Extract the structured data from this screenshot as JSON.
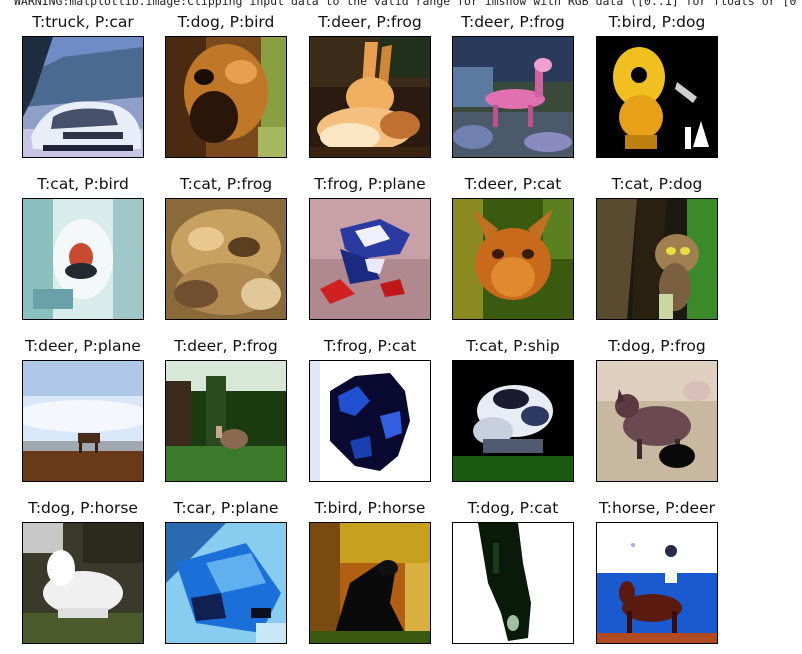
{
  "console": {
    "warning": "WARNING:matplotlib.image:Clipping input data to the valid range for imshow with RGB data ([0..1] for floats or [0"
  },
  "grid": {
    "rows": [
      [
        {
          "label": "T:truck, P:car"
        },
        {
          "label": "T:dog, P:bird"
        },
        {
          "label": "T:deer, P:frog"
        },
        {
          "label": "T:deer, P:frog"
        },
        {
          "label": "T:bird, P:dog"
        }
      ],
      [
        {
          "label": "T:cat, P:bird"
        },
        {
          "label": "T:cat, P:frog"
        },
        {
          "label": "T:frog, P:plane"
        },
        {
          "label": "T:deer, P:cat"
        },
        {
          "label": "T:cat, P:dog"
        }
      ],
      [
        {
          "label": "T:deer, P:plane"
        },
        {
          "label": "T:deer, P:frog"
        },
        {
          "label": "T:frog, P:cat"
        },
        {
          "label": "T:cat, P:ship"
        },
        {
          "label": "T:dog, P:frog"
        }
      ],
      [
        {
          "label": "T:dog, P:horse"
        },
        {
          "label": "T:car, P:plane"
        },
        {
          "label": "T:bird, P:horse"
        },
        {
          "label": "T:dog, P:cat"
        },
        {
          "label": "T:horse, P:deer"
        }
      ]
    ]
  }
}
